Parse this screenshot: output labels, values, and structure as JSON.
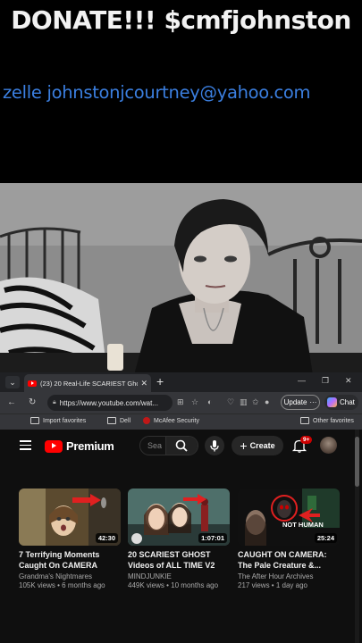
{
  "overlay": {
    "donate_text": "DONATE!!! $cmfjohnston",
    "zelle_text": "zelle johnstonjcourtney@yahoo.com"
  },
  "browser": {
    "tab": {
      "title": "(23) 20 Real-Life SCARIEST Ghost",
      "close": "✕"
    },
    "new_tab": "+",
    "window_controls": [
      "—",
      "❐",
      "✕"
    ],
    "url": "https://www.youtube.com/wat...",
    "update_label": "Update",
    "update_more": "···",
    "chat_label": "Chat",
    "favorites": [
      {
        "label": "Import favorites",
        "icon": "import-icon"
      },
      {
        "label": "Dell",
        "icon": "folder-icon"
      },
      {
        "label": "McAfee Security",
        "icon": "mcafee-icon"
      },
      {
        "label": "Other favorites",
        "icon": "folder-icon"
      }
    ]
  },
  "youtube": {
    "logo_text": "Premium",
    "search_placeholder": "Sea",
    "create_label": "Create",
    "notification_count": "9+",
    "videos": [
      {
        "title": "7 Terrifying Moments Caught On CAMERA",
        "channel": "Grandma's Nightmares",
        "meta": "105K views • 6 months ago",
        "duration": "42:30"
      },
      {
        "title": "20 SCARIEST GHOST Videos of ALL TIME V2",
        "channel": "MINDJUNKIE",
        "meta": "449K views • 10 months ago",
        "duration": "1:07:01"
      },
      {
        "title": "CAUGHT ON CAMERA: The Pale Creature &...",
        "channel": "The After Hour Archives",
        "meta": "217 views • 1 day ago",
        "duration": "25:24",
        "thumb_text": "NOT HUMAN"
      }
    ]
  },
  "colors": {
    "zelle_blue": "#3b7fe0",
    "youtube_red": "#ff0000",
    "page_bg": "#0f0f0f"
  }
}
